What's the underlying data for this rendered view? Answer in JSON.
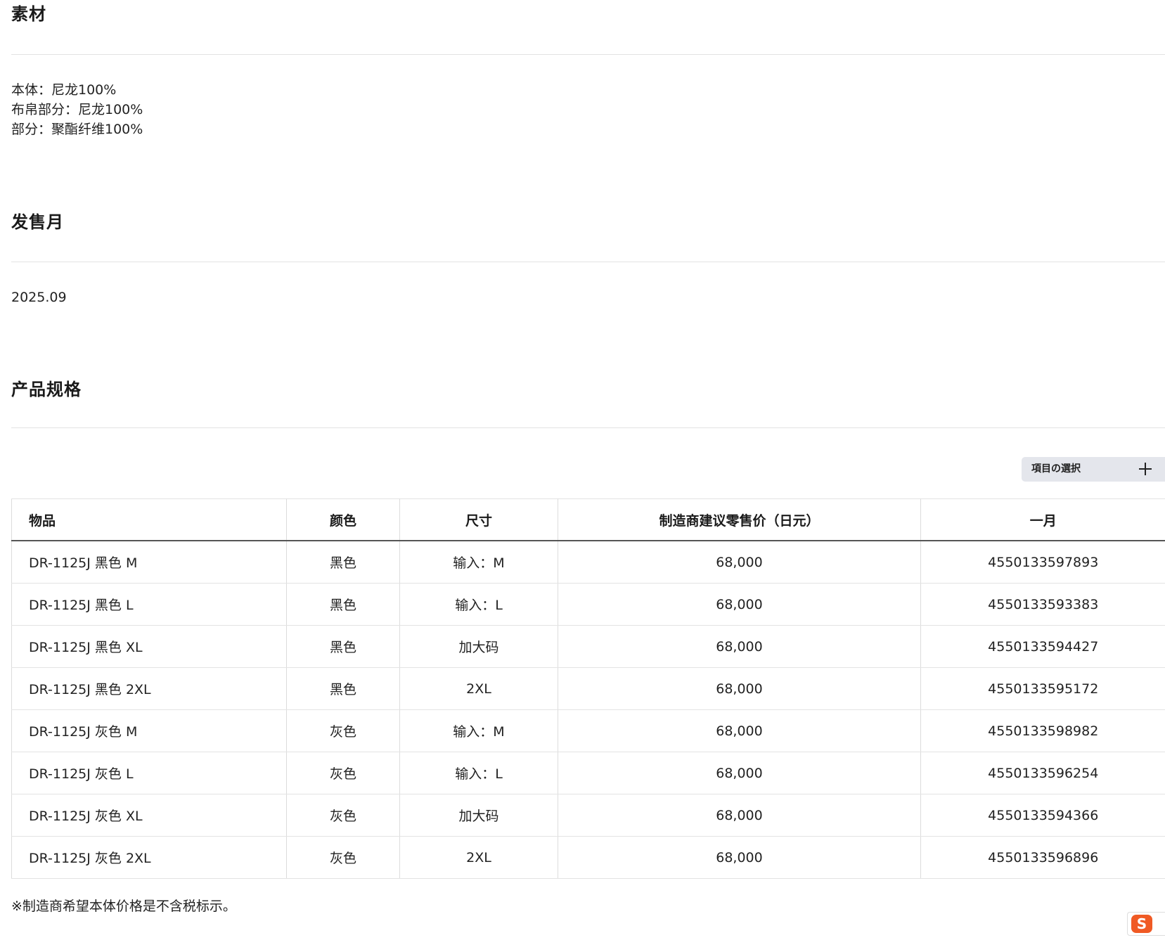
{
  "material": {
    "title": "素材",
    "lines": [
      "本体：尼龙100%",
      "布帛部分：尼龙100%",
      "部分：聚酯纤维100%"
    ]
  },
  "release": {
    "title": "发售月",
    "value": "2025.09"
  },
  "specs": {
    "title": "产品规格",
    "select_button_label": "項目の選択",
    "columns": [
      "物品",
      "颜色",
      "尺寸",
      "制造商建议零售价（日元）",
      "一月"
    ],
    "rows": [
      [
        "DR-1125J 黑色 M",
        "黑色",
        "输入：M",
        "68,000",
        "4550133597893"
      ],
      [
        "DR-1125J 黑色 L",
        "黑色",
        "输入：L",
        "68,000",
        "4550133593383"
      ],
      [
        "DR-1125J 黑色 XL",
        "黑色",
        "加大码",
        "68,000",
        "4550133594427"
      ],
      [
        "DR-1125J 黑色 2XL",
        "黑色",
        "2XL",
        "68,000",
        "4550133595172"
      ],
      [
        "DR-1125J 灰色 M",
        "灰色",
        "输入：M",
        "68,000",
        "4550133598982"
      ],
      [
        "DR-1125J 灰色 L",
        "灰色",
        "输入：L",
        "68,000",
        "4550133596254"
      ],
      [
        "DR-1125J 灰色 XL",
        "灰色",
        "加大码",
        "68,000",
        "4550133594366"
      ],
      [
        "DR-1125J 灰色 2XL",
        "灰色",
        "2XL",
        "68,000",
        "4550133596896"
      ]
    ],
    "footnote": "※制造商希望本体价格是不含税标示。"
  },
  "tray": {
    "ime_icon": "sogou-ime-icon",
    "ime_glyph": "S",
    "ime_color": "#f05a24"
  }
}
